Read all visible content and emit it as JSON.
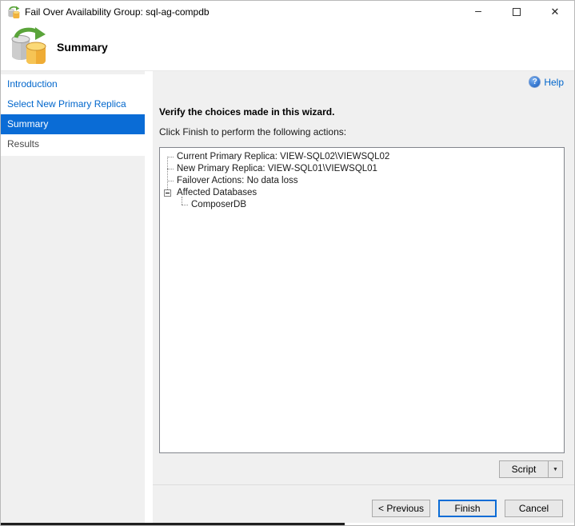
{
  "window": {
    "title": "Fail Over Availability Group: sql-ag-compdb"
  },
  "icons": {
    "minimize": "–",
    "close": "✕",
    "help_qmark": "?",
    "dropdown_arrow": "▼"
  },
  "header": {
    "title": "Summary"
  },
  "sidebar": {
    "items": [
      {
        "label": "Introduction",
        "state": "link"
      },
      {
        "label": "Select New Primary Replica",
        "state": "link"
      },
      {
        "label": "Summary",
        "state": "selected"
      },
      {
        "label": "Results",
        "state": "plain"
      }
    ]
  },
  "main": {
    "help_label": "Help",
    "verify_heading": "Verify the choices made in this wizard.",
    "instruction": "Click Finish to perform the following actions:",
    "tree": {
      "rows": [
        {
          "label": "Current Primary Replica: VIEW-SQL02\\VIEWSQL02",
          "level": 1
        },
        {
          "label": "New Primary Replica: VIEW-SQL01\\VIEWSQL01",
          "level": 1
        },
        {
          "label": "Failover Actions: No data loss",
          "level": 1
        },
        {
          "label": "Affected Databases",
          "level": 1,
          "expanded": true
        },
        {
          "label": "ComposerDB",
          "level": 2
        }
      ]
    },
    "script_button_label": "Script",
    "buttons": {
      "previous": "< Previous",
      "finish": "Finish",
      "cancel": "Cancel"
    }
  },
  "colors": {
    "accent_blue": "#0a6cd6",
    "link_blue": "#0066cc",
    "panel_gray": "#f0f0f0",
    "icon_green": "#5aa43a",
    "icon_yellow": "#f2b33d",
    "icon_gray": "#c2c2c2"
  }
}
